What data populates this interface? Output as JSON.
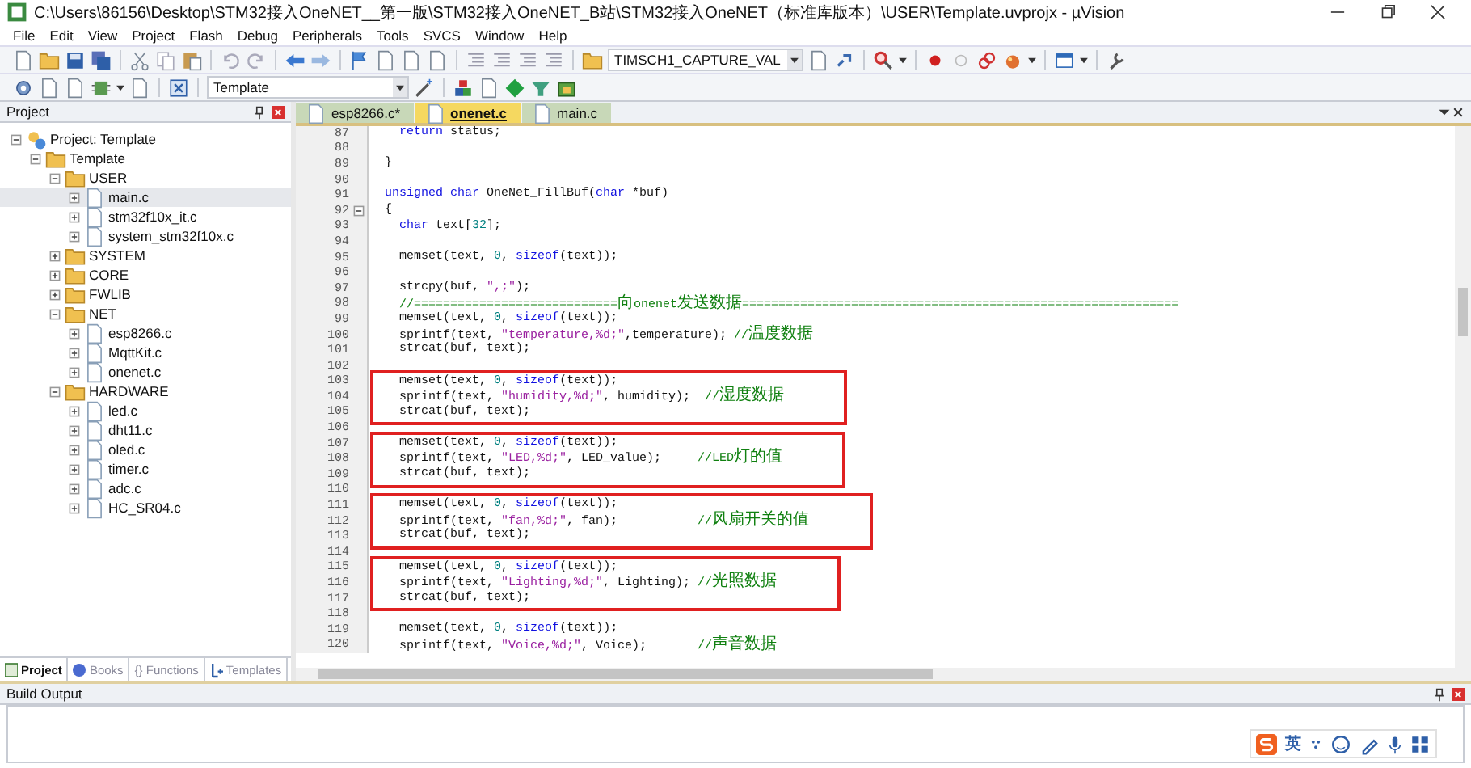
{
  "window": {
    "title": "C:\\Users\\86156\\Desktop\\STM32接入OneNET__第一版\\STM32接入OneNET_B站\\STM32接入OneNET（标准库版本）\\USER\\Template.uvprojx - µVision"
  },
  "menu": [
    "File",
    "Edit",
    "View",
    "Project",
    "Flash",
    "Debug",
    "Peripherals",
    "Tools",
    "SVCS",
    "Window",
    "Help"
  ],
  "toolbar": {
    "find_combo": "TIMSCH1_CAPTURE_VAL",
    "target_combo": "Template"
  },
  "project_panel": {
    "title": "Project",
    "tree": [
      {
        "label": "Project: Template",
        "kind": "project",
        "expanded": true,
        "selected": false,
        "children": [
          {
            "label": "Template",
            "kind": "folder",
            "expanded": true,
            "selected": false,
            "children": [
              {
                "label": "USER",
                "kind": "folder",
                "expanded": true,
                "selected": false,
                "children": [
                  {
                    "label": "main.c",
                    "kind": "file",
                    "expanded": false,
                    "selected": true
                  },
                  {
                    "label": "stm32f10x_it.c",
                    "kind": "file",
                    "expanded": false,
                    "selected": false
                  },
                  {
                    "label": "system_stm32f10x.c",
                    "kind": "file",
                    "expanded": false,
                    "selected": false
                  }
                ]
              },
              {
                "label": "SYSTEM",
                "kind": "folder",
                "expanded": false,
                "selected": false
              },
              {
                "label": "CORE",
                "kind": "folder",
                "expanded": false,
                "selected": false
              },
              {
                "label": "FWLIB",
                "kind": "folder",
                "expanded": false,
                "selected": false
              },
              {
                "label": "NET",
                "kind": "folder",
                "expanded": true,
                "selected": false,
                "children": [
                  {
                    "label": "esp8266.c",
                    "kind": "file",
                    "expanded": false,
                    "selected": false
                  },
                  {
                    "label": "MqttKit.c",
                    "kind": "file",
                    "expanded": false,
                    "selected": false
                  },
                  {
                    "label": "onenet.c",
                    "kind": "file",
                    "expanded": false,
                    "selected": false
                  }
                ]
              },
              {
                "label": "HARDWARE",
                "kind": "folder",
                "expanded": true,
                "selected": false,
                "children": [
                  {
                    "label": "led.c",
                    "kind": "file",
                    "expanded": false,
                    "selected": false
                  },
                  {
                    "label": "dht11.c",
                    "kind": "file",
                    "expanded": false,
                    "selected": false
                  },
                  {
                    "label": "oled.c",
                    "kind": "file",
                    "expanded": false,
                    "selected": false
                  },
                  {
                    "label": "timer.c",
                    "kind": "file",
                    "expanded": false,
                    "selected": false
                  },
                  {
                    "label": "adc.c",
                    "kind": "file",
                    "expanded": false,
                    "selected": false
                  },
                  {
                    "label": "HC_SR04.c",
                    "kind": "file",
                    "expanded": false,
                    "selected": false
                  }
                ]
              }
            ]
          }
        ]
      }
    ],
    "tabs": [
      {
        "label": "Project",
        "kind": "project",
        "selected": true
      },
      {
        "label": "Books",
        "kind": "books",
        "selected": false
      },
      {
        "label": "{} Functions",
        "kind": "functions",
        "selected": false
      },
      {
        "label": "Templates",
        "kind": "templates",
        "selected": false
      }
    ]
  },
  "editor": {
    "tabs": [
      {
        "label": "esp8266.c*",
        "selected": false
      },
      {
        "label": "onenet.c",
        "selected": true
      },
      {
        "label": "main.c",
        "selected": false
      }
    ],
    "blocks": [
      {
        "boxed": false,
        "lines": [
          {
            "num": "87",
            "segs": [
              {
                "kind": "kw",
                "text": "  return"
              },
              {
                "kind": "plain",
                "text": " status;"
              }
            ]
          },
          {
            "num": "88"
          },
          {
            "num": "89",
            "segs": [
              {
                "kind": "plain",
                "text": "}"
              }
            ]
          },
          {
            "num": "90"
          },
          {
            "num": "91",
            "segs": [
              {
                "kind": "kw",
                "text": "unsigned char"
              },
              {
                "kind": "plain",
                "text": " OneNet_FillBuf("
              },
              {
                "kind": "kw",
                "text": "char"
              },
              {
                "kind": "plain",
                "text": " *buf)"
              }
            ]
          },
          {
            "num": "92",
            "fold_expanded": true,
            "segs": [
              {
                "kind": "plain",
                "text": "{"
              }
            ]
          },
          {
            "num": "93",
            "segs": [
              {
                "kind": "kw",
                "text": "  char"
              },
              {
                "kind": "plain",
                "text": " text["
              },
              {
                "kind": "num",
                "text": "32"
              },
              {
                "kind": "plain",
                "text": "];"
              }
            ]
          },
          {
            "num": "94"
          },
          {
            "num": "95",
            "segs": [
              {
                "kind": "plain",
                "text": "  memset(text, "
              },
              {
                "kind": "num",
                "text": "0"
              },
              {
                "kind": "plain",
                "text": ", "
              },
              {
                "kind": "kw",
                "text": "sizeof"
              },
              {
                "kind": "plain",
                "text": "(text));"
              }
            ]
          },
          {
            "num": "96"
          },
          {
            "num": "97",
            "segs": [
              {
                "kind": "plain",
                "text": "  strcpy(buf, "
              },
              {
                "kind": "str",
                "text": "\",;\""
              },
              {
                "kind": "plain",
                "text": ");"
              }
            ]
          },
          {
            "num": "98",
            "segs": [
              {
                "kind": "cmt",
                "text": "  //============================向onenet发送数据============================================================"
              }
            ]
          },
          {
            "num": "99",
            "segs": [
              {
                "kind": "plain",
                "text": "  memset(text, "
              },
              {
                "kind": "num",
                "text": "0"
              },
              {
                "kind": "plain",
                "text": ", "
              },
              {
                "kind": "kw",
                "text": "sizeof"
              },
              {
                "kind": "plain",
                "text": "(text));"
              }
            ]
          },
          {
            "num": "100",
            "segs": [
              {
                "kind": "plain",
                "text": "  sprintf(text, "
              },
              {
                "kind": "str",
                "text": "\"temperature,%d;\""
              },
              {
                "kind": "plain",
                "text": ",temperature); "
              },
              {
                "kind": "cmt",
                "text": "//温度数据"
              }
            ]
          },
          {
            "num": "101",
            "segs": [
              {
                "kind": "plain",
                "text": "  strcat(buf, text);"
              }
            ]
          },
          {
            "num": "102"
          }
        ]
      },
      {
        "boxed": true,
        "lines": [
          {
            "num": "103",
            "segs": [
              {
                "kind": "plain",
                "text": "  memset(text, "
              },
              {
                "kind": "num",
                "text": "0"
              },
              {
                "kind": "plain",
                "text": ", "
              },
              {
                "kind": "kw",
                "text": "sizeof"
              },
              {
                "kind": "plain",
                "text": "(text));"
              }
            ]
          },
          {
            "num": "104",
            "segs": [
              {
                "kind": "plain",
                "text": "  sprintf(text, "
              },
              {
                "kind": "str",
                "text": "\"humidity,%d;\""
              },
              {
                "kind": "plain",
                "text": ", humidity);  "
              },
              {
                "kind": "cmt",
                "text": "//湿度数据"
              }
            ]
          },
          {
            "num": "105",
            "segs": [
              {
                "kind": "plain",
                "text": "  strcat(buf, text);"
              }
            ]
          }
        ]
      },
      {
        "boxed": false,
        "lines": [
          {
            "num": "106"
          }
        ]
      },
      {
        "boxed": true,
        "lines": [
          {
            "num": "107",
            "segs": [
              {
                "kind": "plain",
                "text": "  memset(text, "
              },
              {
                "kind": "num",
                "text": "0"
              },
              {
                "kind": "plain",
                "text": ", "
              },
              {
                "kind": "kw",
                "text": "sizeof"
              },
              {
                "kind": "plain",
                "text": "(text));"
              }
            ]
          },
          {
            "num": "108",
            "segs": [
              {
                "kind": "plain",
                "text": "  sprintf(text, "
              },
              {
                "kind": "str",
                "text": "\"LED,%d;\""
              },
              {
                "kind": "plain",
                "text": ", LED_value);     "
              },
              {
                "kind": "cmt",
                "text": "//LED灯的值"
              }
            ]
          },
          {
            "num": "109",
            "segs": [
              {
                "kind": "plain",
                "text": "  strcat(buf, text);"
              }
            ]
          }
        ]
      },
      {
        "boxed": false,
        "lines": [
          {
            "num": "110"
          }
        ]
      },
      {
        "boxed": true,
        "lines": [
          {
            "num": "111",
            "segs": [
              {
                "kind": "plain",
                "text": "  memset(text, "
              },
              {
                "kind": "num",
                "text": "0"
              },
              {
                "kind": "plain",
                "text": ", "
              },
              {
                "kind": "kw",
                "text": "sizeof"
              },
              {
                "kind": "plain",
                "text": "(text));"
              }
            ]
          },
          {
            "num": "112",
            "segs": [
              {
                "kind": "plain",
                "text": "  sprintf(text, "
              },
              {
                "kind": "str",
                "text": "\"fan,%d;\""
              },
              {
                "kind": "plain",
                "text": ", fan);           "
              },
              {
                "kind": "cmt",
                "text": "//风扇开关的值"
              }
            ]
          },
          {
            "num": "113",
            "segs": [
              {
                "kind": "plain",
                "text": "  strcat(buf, text);"
              }
            ]
          }
        ]
      },
      {
        "boxed": false,
        "lines": [
          {
            "num": "114"
          }
        ]
      },
      {
        "boxed": true,
        "lines": [
          {
            "num": "115",
            "segs": [
              {
                "kind": "plain",
                "text": "  memset(text, "
              },
              {
                "kind": "num",
                "text": "0"
              },
              {
                "kind": "plain",
                "text": ", "
              },
              {
                "kind": "kw",
                "text": "sizeof"
              },
              {
                "kind": "plain",
                "text": "(text));"
              }
            ]
          },
          {
            "num": "116",
            "segs": [
              {
                "kind": "plain",
                "text": "  sprintf(text, "
              },
              {
                "kind": "str",
                "text": "\"Lighting,%d;\""
              },
              {
                "kind": "plain",
                "text": ", Lighting); "
              },
              {
                "kind": "cmt",
                "text": "//光照数据"
              }
            ]
          },
          {
            "num": "117",
            "segs": [
              {
                "kind": "plain",
                "text": "  strcat(buf, text);"
              }
            ]
          }
        ]
      },
      {
        "boxed": false,
        "lines": [
          {
            "num": "118"
          },
          {
            "num": "119",
            "segs": [
              {
                "kind": "plain",
                "text": "  memset(text, "
              },
              {
                "kind": "num",
                "text": "0"
              },
              {
                "kind": "plain",
                "text": ", "
              },
              {
                "kind": "kw",
                "text": "sizeof"
              },
              {
                "kind": "plain",
                "text": "(text));"
              }
            ]
          },
          {
            "num": "120",
            "segs": [
              {
                "kind": "plain",
                "text": "  sprintf(text, "
              },
              {
                "kind": "str",
                "text": "\"Voice,%d;\""
              },
              {
                "kind": "plain",
                "text": ", Voice);       "
              },
              {
                "kind": "cmt",
                "text": "//声音数据"
              }
            ]
          }
        ]
      }
    ]
  },
  "build_output": {
    "title": "Build Output"
  },
  "ime_bar": {
    "mode_label": "英"
  }
}
